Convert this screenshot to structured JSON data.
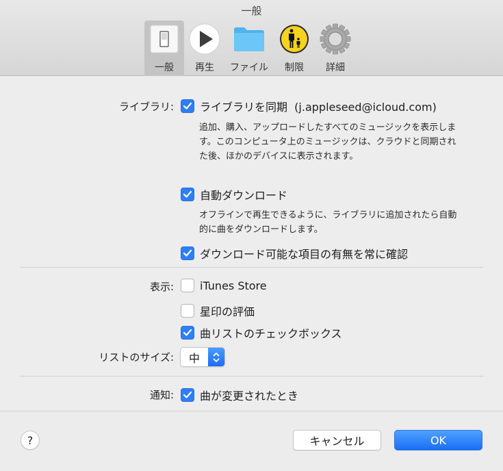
{
  "window": {
    "title": "一般"
  },
  "toolbar": {
    "tabs": [
      {
        "label": "一般",
        "icon": "switch-icon",
        "selected": true
      },
      {
        "label": "再生",
        "icon": "play-icon",
        "selected": false
      },
      {
        "label": "ファイル",
        "icon": "folder-icon",
        "selected": false
      },
      {
        "label": "制限",
        "icon": "parental-controls-icon",
        "selected": false
      },
      {
        "label": "詳細",
        "icon": "gear-icon",
        "selected": false
      }
    ]
  },
  "library": {
    "label": "ライブラリ:",
    "sync": {
      "label": "ライブラリを同期  (j.appleseed@icloud.com)",
      "checked": true,
      "description": "追加、購入、アップロードしたすべてのミュージックを表示します。このコンピュータ上のミュージックは、クラウドと同期された後、ほかのデバイスに表示されます。"
    },
    "auto_download": {
      "label": "自動ダウンロード",
      "checked": true,
      "description": "オフラインで再生できるように、ライブラリに追加されたら自動的に曲をダウンロードします。"
    },
    "check_downloads": {
      "label": "ダウンロード可能な項目の有無を常に確認",
      "checked": true
    }
  },
  "show": {
    "label": "表示:",
    "itunes_store": {
      "label": "iTunes Store",
      "checked": false
    },
    "star_ratings": {
      "label": "星印の評価",
      "checked": false
    },
    "song_checkboxes": {
      "label": "曲リストのチェックボックス",
      "checked": true
    }
  },
  "list_size": {
    "label": "リストのサイズ:",
    "value": "中"
  },
  "notifications": {
    "label": "通知:",
    "song_changes": {
      "label": "曲が変更されたとき",
      "checked": true
    }
  },
  "footer": {
    "help": "?",
    "cancel": "キャンセル",
    "ok": "OK"
  },
  "colors": {
    "accent": "#2f7ef6",
    "ok_button": "#1a6ff3"
  }
}
